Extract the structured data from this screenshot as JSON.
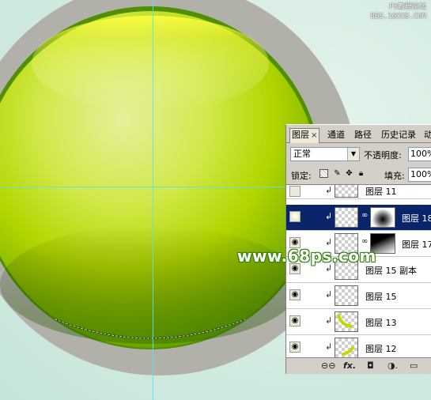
{
  "watermark_top": {
    "line1": "PS教程论坛",
    "line2": "BBS.16XX8.COM"
  },
  "watermark_center": "www.68ps.com",
  "panel": {
    "tabs": [
      {
        "label": "图层",
        "active": true,
        "close": "×"
      },
      {
        "label": "通道",
        "active": false
      },
      {
        "label": "路径",
        "active": false
      },
      {
        "label": "历史记录",
        "active": false
      },
      {
        "label": "动",
        "active": false
      }
    ],
    "blend_mode": "正常",
    "blend_arrow": "▼",
    "opacity_label": "不透明度:",
    "opacity_value": "100%",
    "lock_label": "锁定:",
    "fill_label": "填充:",
    "fill_value": "100%",
    "layers": [
      {
        "name": "图层 11",
        "visible": false,
        "clipped": true,
        "selected": false,
        "mask": null
      },
      {
        "name": "图层 18",
        "visible": true,
        "clipped": true,
        "selected": true,
        "mask": "soft"
      },
      {
        "name": "图层 17",
        "visible": true,
        "clipped": true,
        "selected": false,
        "mask": "gradient"
      },
      {
        "name": "图层 15 副本",
        "visible": true,
        "clipped": true,
        "selected": false,
        "mask": null
      },
      {
        "name": "图层 15",
        "visible": true,
        "clipped": true,
        "selected": false,
        "mask": null
      },
      {
        "name": "图层 13",
        "visible": true,
        "clipped": true,
        "selected": false,
        "mask": null
      },
      {
        "name": "图层 12",
        "visible": true,
        "clipped": true,
        "selected": false,
        "mask": null
      }
    ],
    "footer": {
      "link": "⊖⊖",
      "fx": "fx.",
      "mask": "◘",
      "adjust": "◑.",
      "group": "▭"
    }
  },
  "colors": {
    "ball_light": "#e6ef9a",
    "ball_mid": "#b9df00",
    "ball_dark": "#5f9a00",
    "rim": "#b1b1aa",
    "guide": "#4ee8f0",
    "selection": "#0a246a"
  },
  "icons": {
    "eye": "eye-icon",
    "clip": "clip-arrow-icon",
    "chain": "chain-link-icon"
  }
}
